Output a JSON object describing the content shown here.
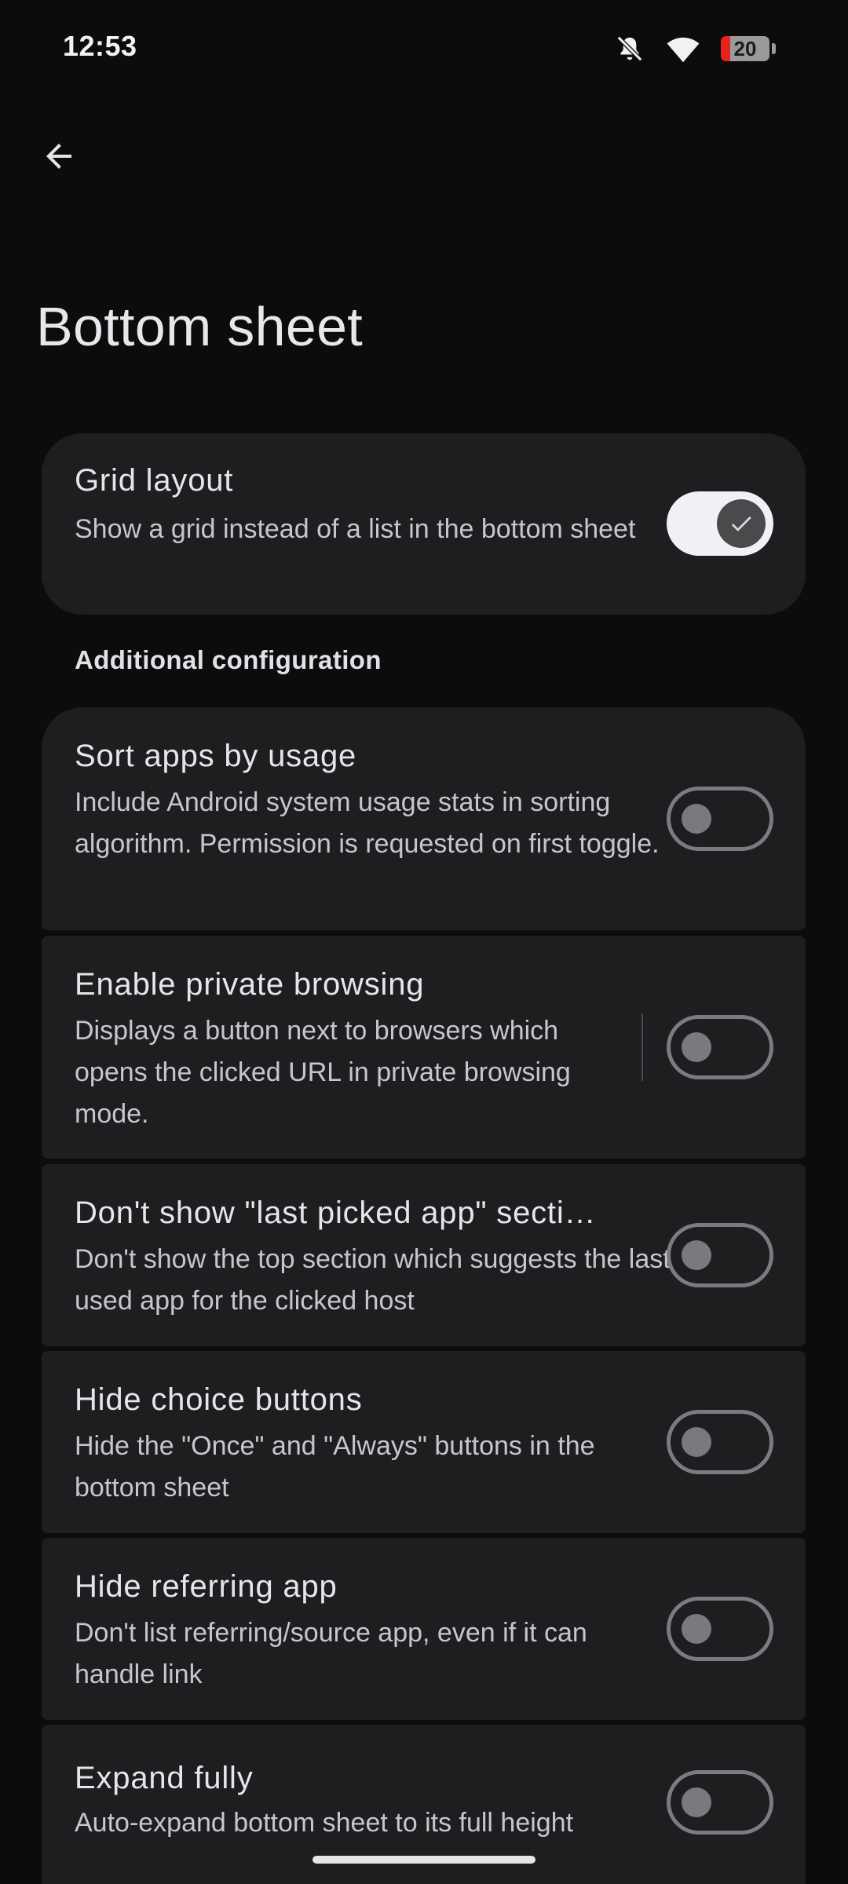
{
  "status_bar": {
    "time": "12:53",
    "icons": [
      "mute-icon",
      "wifi-icon",
      "battery-icon"
    ],
    "battery_level": "20",
    "battery_fraction": 0.2
  },
  "toolbar": {
    "back_icon": "arrow-left-icon"
  },
  "page": {
    "title": "Bottom sheet"
  },
  "main_setting": {
    "title": "Grid layout",
    "description": "Show a grid instead of a list in the bottom sheet",
    "enabled": true
  },
  "section": {
    "header": "Additional configuration"
  },
  "settings": [
    {
      "title": "Sort apps by usage",
      "description": "Include Android system usage stats in sorting algorithm. Permission is requested on first toggle.",
      "enabled": false
    },
    {
      "title": "Enable private browsing",
      "description": "Displays a button next to browsers which opens the clicked URL in private browsing mode.",
      "enabled": false
    },
    {
      "title": "Don't show \"last picked app\" secti…",
      "description": "Don't show the top section which suggests the last used app for the clicked host",
      "enabled": false
    },
    {
      "title": "Hide choice buttons",
      "description": "Hide the \"Once\" and \"Always\" buttons in the bottom sheet",
      "enabled": false
    },
    {
      "title": "Hide referring app",
      "description": "Don't list referring/source app, even if it can handle link",
      "enabled": false
    },
    {
      "title": "Expand fully",
      "description": "Auto-expand bottom sheet to its full height",
      "enabled": false
    }
  ],
  "colors": {
    "background": "#0c0c0d",
    "card": "#1e1e20",
    "toggle_on_track": "#f2f0f4",
    "toggle_off_border": "#7d7a80",
    "battery_low": "#e5251d"
  }
}
